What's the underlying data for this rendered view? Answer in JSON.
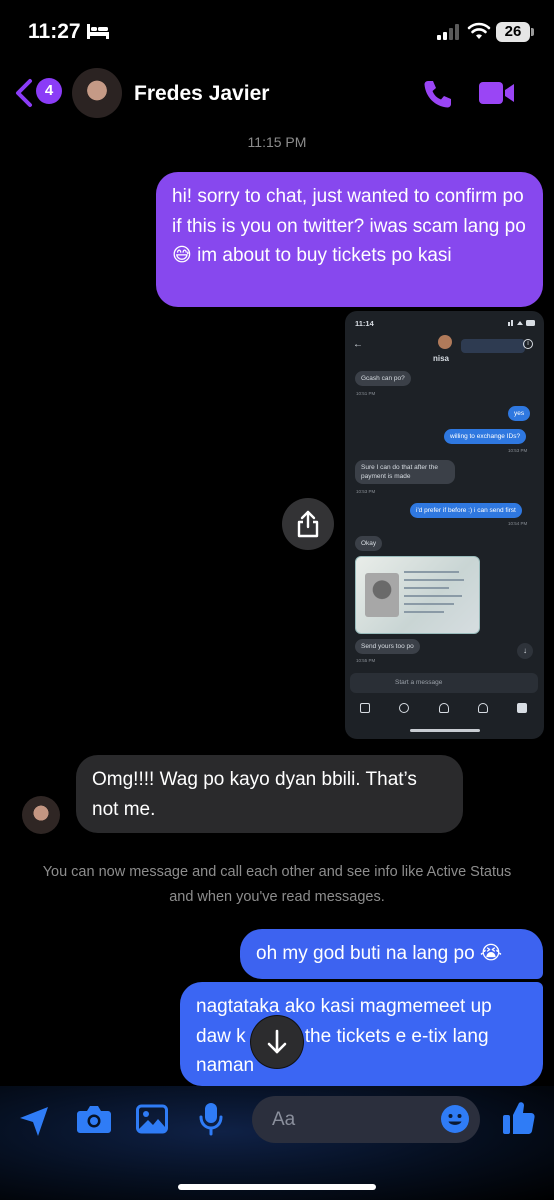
{
  "status_bar": {
    "time": "11:27",
    "battery": "26"
  },
  "header": {
    "back_badge": "4",
    "contact_name": "Fredes Javier"
  },
  "thread": {
    "timestamp": "11:15 PM",
    "message_1": "hi! sorry to chat, just wanted to confirm po if this is you on twitter? iwas scam lang po 😅 im about to buy tickets po kasi",
    "message_2": "Omg!!!! Wag po kayo dyan bbili. That’s not me.",
    "system_notice": "You can now message and call each other and see info like Active Status and when you've read messages.",
    "message_3": "oh my god buti na lang po 😭",
    "message_4": "nagtataka ako kasi magmemeet up daw k         r the tickets e e-tix lang naman"
  },
  "embedded_screenshot": {
    "time": "11:14",
    "name": "nisa",
    "messages": [
      {
        "text": "Gcash can po?",
        "time": "10:51 PM"
      },
      {
        "text": "yes",
        "time": ""
      },
      {
        "text": "willing to exchange IDs?",
        "time": "10:53 PM"
      },
      {
        "text": "Sure I can do that after the payment is made",
        "time": "10:53 PM"
      },
      {
        "text": "i'd prefer if before :) i can send first",
        "time": "10:54 PM"
      },
      {
        "text": "Okay",
        "time": ""
      },
      {
        "text": "Send yours too po",
        "time": "10:55 PM"
      }
    ],
    "input_placeholder": "Start a message"
  },
  "composer": {
    "placeholder": "Aa"
  },
  "colors": {
    "accent_purple": "#8748ee",
    "outgoing_blue": "#3b66f3",
    "incoming_gray": "#2a2a2c"
  }
}
